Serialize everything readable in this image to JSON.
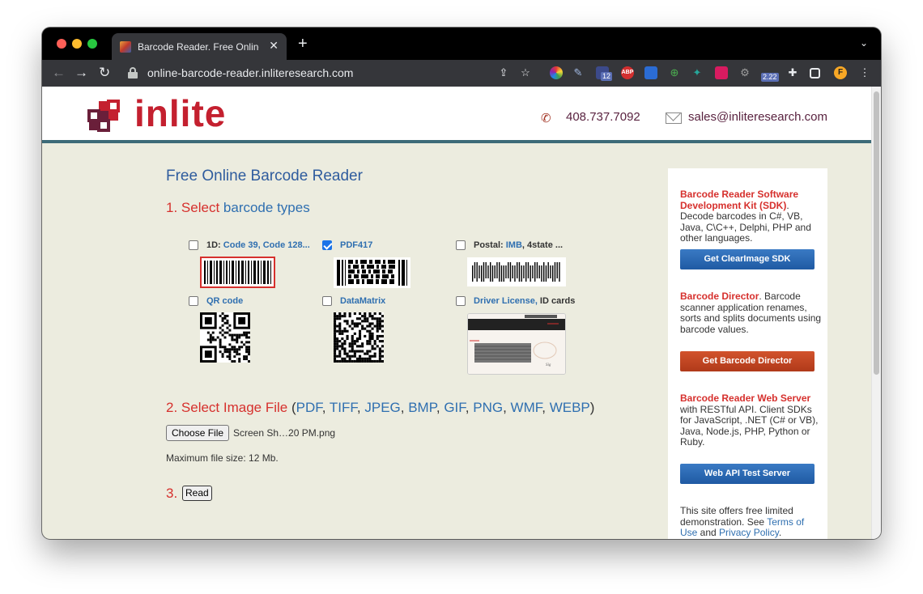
{
  "browser": {
    "tab_title": "Barcode Reader. Free Online W",
    "tab_close": "✕",
    "new_tab": "+",
    "tab_menu": "⌄",
    "url": "online-barcode-reader.inliteresearch.com",
    "extension_badges": {
      "ext_12": "12",
      "abp": "ABP",
      "ver": "2.22"
    }
  },
  "header": {
    "logo": "inlite",
    "phone": "408.737.7092",
    "email": "sales@inliteresearch.com"
  },
  "main": {
    "title": "Free Online Barcode Reader",
    "step1": {
      "num": "1.",
      "select": "Select",
      "rest": "barcode types"
    },
    "barcode_types": [
      {
        "prefix": "1D:",
        "link": "Code 39, Code 128...",
        "suffix": "",
        "checked": false
      },
      {
        "prefix": "",
        "link": "PDF417",
        "suffix": "",
        "checked": true
      },
      {
        "prefix": "Postal:",
        "link": "IMB",
        "suffix": ", 4state ...",
        "checked": false
      },
      {
        "prefix": "",
        "link": "QR code",
        "suffix": "",
        "checked": false
      },
      {
        "prefix": "",
        "link": "DataMatrix",
        "suffix": "",
        "checked": false
      },
      {
        "prefix": "",
        "link": "Driver License,",
        "suffix": " ID cards",
        "checked": false
      }
    ],
    "step2": {
      "label": "2. Select Image File",
      "open": " (",
      "formats": [
        "PDF",
        "TIFF",
        "JPEG",
        "BMP",
        "GIF",
        "PNG",
        "WMF",
        "WEBP"
      ],
      "sep": ", ",
      "close": ")"
    },
    "choose_file": "Choose File",
    "file_name": "Screen Sh…20 PM.png",
    "max_size": "Maximum file size: 12 Mb.",
    "step3": "3.",
    "read": "Read"
  },
  "sidebar": {
    "sdk": {
      "title": "Barcode Reader Software Development Kit (SDK)",
      "text": ". Decode barcodes in C#, VB, Java, C\\C++, Delphi, PHP and other languages.",
      "button": "Get ClearImage SDK"
    },
    "director": {
      "title": "Barcode Director",
      "text": ". Barcode scanner application renames, sorts and splits documents using barcode values.",
      "button": "Get Barcode Director"
    },
    "web": {
      "title": "Barcode Reader Web Server",
      "text": " with RESTful API. Client SDKs for JavaScript, .NET (C# or VB), Java, Node.js, PHP, Python or Ruby.",
      "button": "Web API Test Server"
    },
    "footer": {
      "pre": "This site offers free limited demonstration. See ",
      "terms": "Terms of Use",
      "and": " and ",
      "privacy": "Privacy Policy",
      "end": "."
    }
  },
  "colors": {
    "accent_red": "#d6302d",
    "link_blue": "#2f6fb0",
    "page_bg": "#ececdf"
  }
}
